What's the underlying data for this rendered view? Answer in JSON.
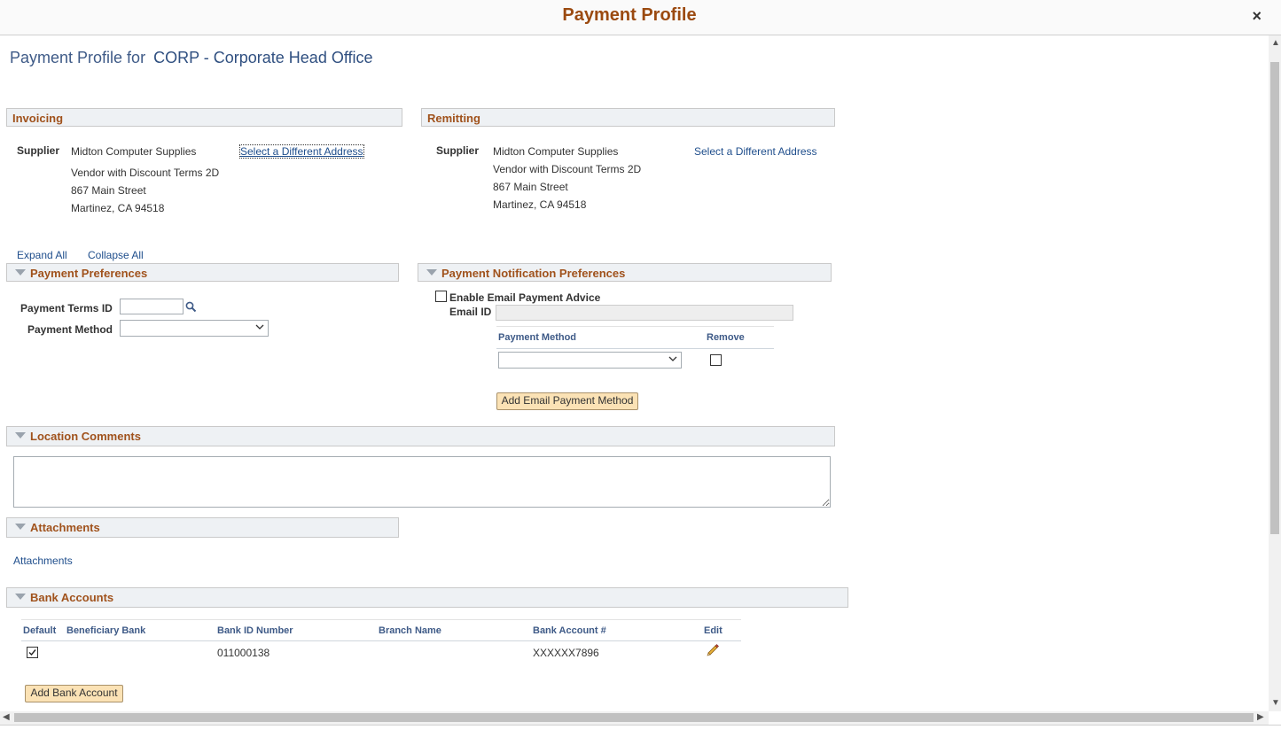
{
  "dialog": {
    "title": "Payment Profile",
    "close_glyph": "×"
  },
  "heading": {
    "prefix": "Payment Profile for",
    "org": "CORP - Corporate Head Office"
  },
  "invoicing": {
    "section": "Invoicing",
    "supplier_label": "Supplier",
    "address_lines": [
      "Midton Computer Supplies",
      "Vendor with Discount Terms 2D",
      "867 Main Street",
      "Martinez, CA  94518"
    ],
    "select_link": "Select a Different Address"
  },
  "remitting": {
    "section": "Remitting",
    "supplier_label": "Supplier",
    "address_lines": [
      "Midton Computer Supplies",
      "Vendor with Discount Terms 2D",
      "867 Main Street",
      "Martinez, CA  94518"
    ],
    "select_link": "Select a Different Address"
  },
  "expand": {
    "expand_all": "Expand All",
    "collapse_all": "Collapse All"
  },
  "payment_preferences": {
    "section": "Payment Preferences",
    "terms_label": "Payment Terms ID",
    "terms_value": "",
    "method_label": "Payment Method",
    "method_value": ""
  },
  "notification": {
    "section": "Payment Notification Preferences",
    "enable_label": "Enable Email Payment Advice",
    "enable_checked": false,
    "email_label": "Email ID",
    "email_value": "",
    "grid": {
      "col_method": "Payment Method",
      "col_remove": "Remove"
    },
    "add_button": "Add Email Payment Method"
  },
  "location_comments": {
    "section": "Location Comments",
    "value": ""
  },
  "attachments": {
    "section": "Attachments",
    "link": "Attachments"
  },
  "bank_accounts": {
    "section": "Bank Accounts",
    "columns": [
      "Default",
      "Beneficiary Bank",
      "Bank ID Number",
      "Branch Name",
      "Bank Account #",
      "Edit"
    ],
    "rows": [
      {
        "default": true,
        "beneficiary_bank": "",
        "bank_id": "011000138",
        "branch": "",
        "account": "XXXXXX7896"
      }
    ],
    "add_button": "Add Bank Account"
  },
  "colors": {
    "section_title": "#a0521c",
    "dialog_title": "#9b4a10",
    "link": "#1f4e8c",
    "button_bg": "#fbe2b5"
  },
  "icons": {
    "search": "search-icon",
    "edit": "pencil-icon",
    "collapse": "triangle-down-icon"
  }
}
